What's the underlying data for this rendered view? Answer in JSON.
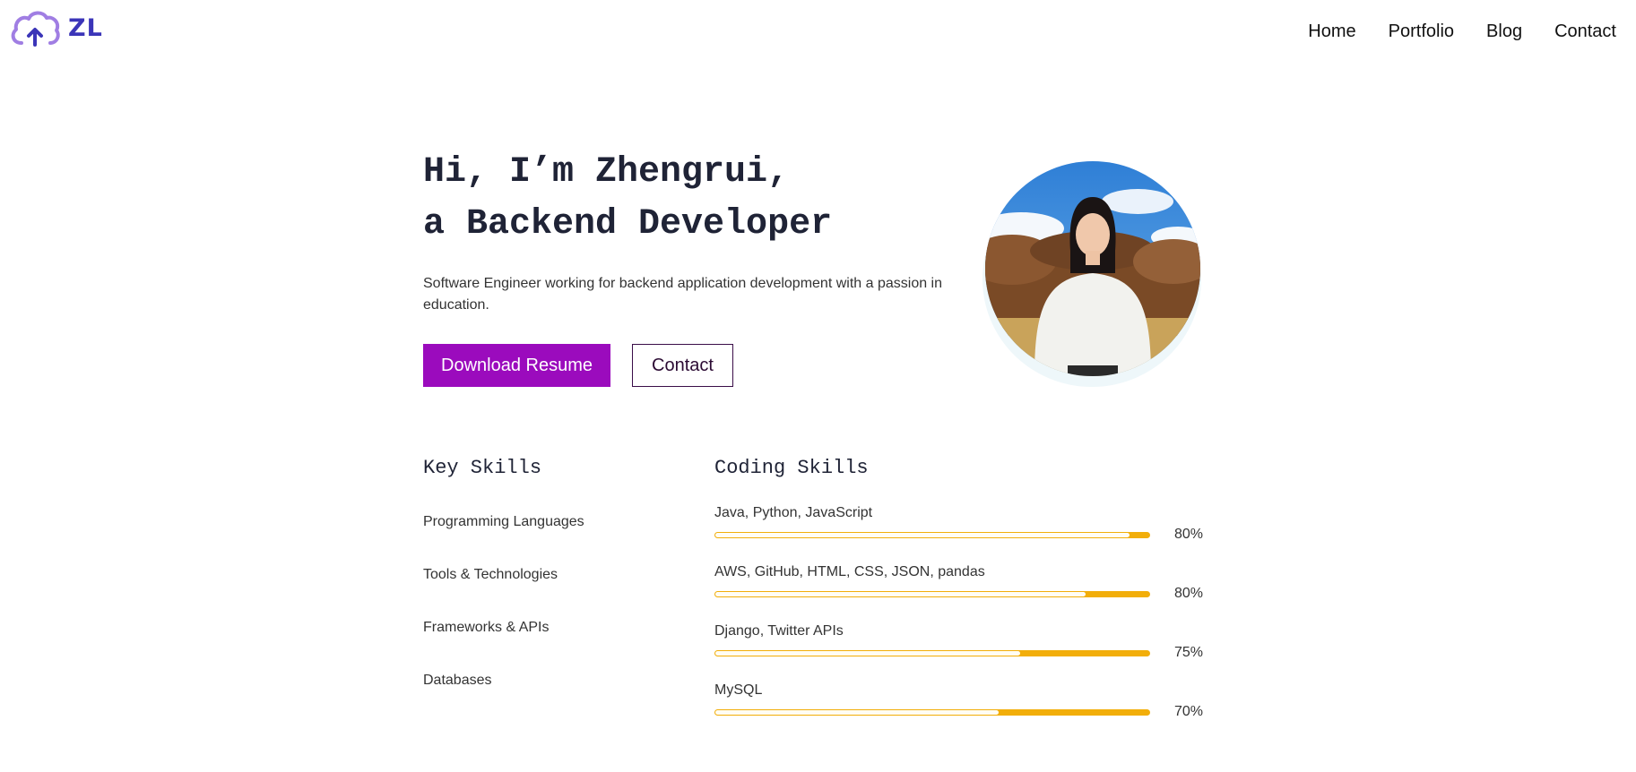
{
  "brand": {
    "logo_text": "ZL",
    "logo_color": "#3b35b8",
    "logo_icon": "cloud-upload-icon"
  },
  "nav": {
    "items": [
      "Home",
      "Portfolio",
      "Blog",
      "Contact"
    ]
  },
  "hero": {
    "title_line1": "Hi, I’m Zhengrui,",
    "title_line2": "a Backend Developer",
    "subtitle": "Software Engineer working for backend application development with a passion in education.",
    "primary_button": "Download Resume",
    "secondary_button": "Contact"
  },
  "key_skills": {
    "title": "Key Skills",
    "items": [
      "Programming Languages",
      "Tools & Technologies",
      "Frameworks & APIs",
      "Databases"
    ]
  },
  "coding_skills": {
    "title": "Coding Skills",
    "items": [
      {
        "label": "Java, Python, JavaScript",
        "percent_text": "80%",
        "track_fraction": 0.95
      },
      {
        "label": "AWS, GitHub, HTML, CSS, JSON, pandas",
        "percent_text": "80%",
        "track_fraction": 0.85
      },
      {
        "label": "Django, Twitter APIs",
        "percent_text": "75%",
        "track_fraction": 0.7
      },
      {
        "label": "MySQL",
        "percent_text": "70%",
        "track_fraction": 0.65
      }
    ]
  },
  "colors": {
    "accent": "#9b0bbd",
    "bar_fill": "#f2ae0a",
    "text_dark": "#1f2336"
  }
}
